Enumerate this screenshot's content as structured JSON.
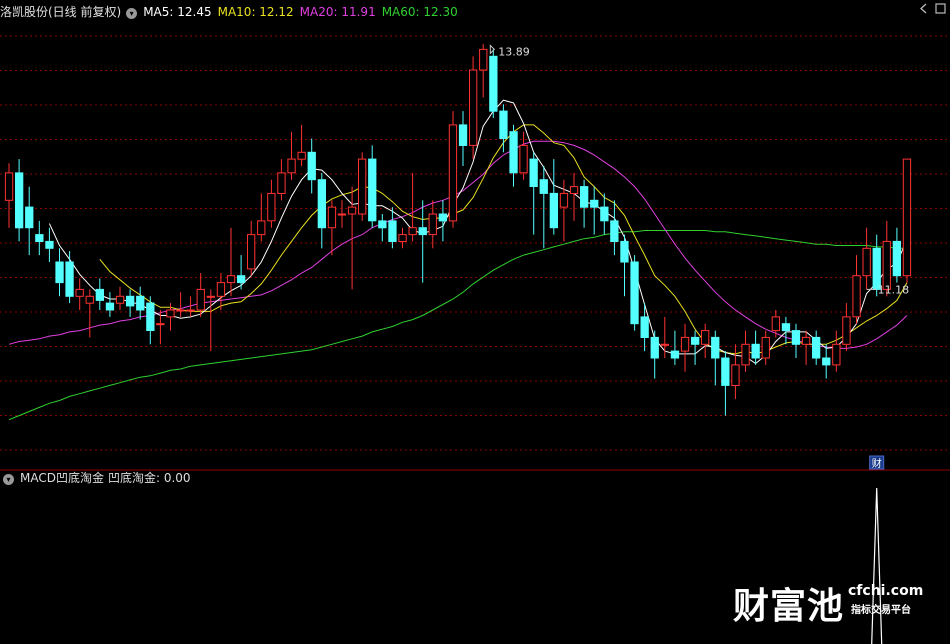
{
  "stock_title": "洛凯股份(日线 前复权)",
  "ma_legend": [
    {
      "label": "MA5: 12.45",
      "color": "#ffffff"
    },
    {
      "label": "MA10: 12.12",
      "color": "#e8e020"
    },
    {
      "label": "MA20: 11.91",
      "color": "#e040e0"
    },
    {
      "label": "MA60: 12.30",
      "color": "#30d030"
    }
  ],
  "indicator_title": "MACD凹底淘金",
  "indicator_value": "凹底淘金: 0.00",
  "watermark": {
    "brand": "财富池",
    "domain": "cfchi.com",
    "slogan": "指标交易平台"
  },
  "colors": {
    "up": "#ff3232",
    "down": "#54ffff",
    "grid": "#8b0000",
    "background": "#000000"
  },
  "chart_data": {
    "type": "candlestick",
    "price_range": [
      10.9,
      14.05
    ],
    "annotations": [
      {
        "text": "13.89",
        "candle_index": 48,
        "kind": "high"
      },
      {
        "text": "11.18",
        "candle_index": 85,
        "kind": "low"
      },
      {
        "text": "财",
        "candle_index": 86,
        "kind": "badge"
      }
    ],
    "candles": [
      [
        12.75,
        12.95,
        13.02,
        12.55
      ],
      [
        12.95,
        12.55,
        13.05,
        12.45
      ],
      [
        12.7,
        12.55,
        12.85,
        12.35
      ],
      [
        12.5,
        12.45,
        12.6,
        12.35
      ],
      [
        12.45,
        12.4,
        12.55,
        12.3
      ],
      [
        12.3,
        12.15,
        12.4,
        12.05
      ],
      [
        12.3,
        12.05,
        12.38,
        12.0
      ],
      [
        12.05,
        12.1,
        12.18,
        11.95
      ],
      [
        12.0,
        12.05,
        12.1,
        11.75
      ],
      [
        12.1,
        12.02,
        12.18,
        11.95
      ],
      [
        12.0,
        11.95,
        12.08,
        11.9
      ],
      [
        12.0,
        12.05,
        12.12,
        11.95
      ],
      [
        12.05,
        11.98,
        12.1,
        11.9
      ],
      [
        12.05,
        11.95,
        12.12,
        11.88
      ],
      [
        12.0,
        11.8,
        12.05,
        11.7
      ],
      [
        11.85,
        11.85,
        11.95,
        11.7
      ],
      [
        11.9,
        11.95,
        12.0,
        11.8
      ],
      [
        11.95,
        11.95,
        12.08,
        11.9
      ],
      [
        11.95,
        11.95,
        12.05,
        11.9
      ],
      [
        11.95,
        12.1,
        12.22,
        11.9
      ],
      [
        12.05,
        12.05,
        12.1,
        11.65
      ],
      [
        12.05,
        12.15,
        12.22,
        11.95
      ],
      [
        12.15,
        12.2,
        12.55,
        12.05
      ],
      [
        12.2,
        12.15,
        12.35,
        12.1
      ],
      [
        12.25,
        12.5,
        12.6,
        12.2
      ],
      [
        12.5,
        12.6,
        12.8,
        12.45
      ],
      [
        12.6,
        12.8,
        12.9,
        12.55
      ],
      [
        12.8,
        12.95,
        13.05,
        12.75
      ],
      [
        12.95,
        13.05,
        13.25,
        12.9
      ],
      [
        13.05,
        13.1,
        13.3,
        13.0
      ],
      [
        13.1,
        12.9,
        13.2,
        12.8
      ],
      [
        12.9,
        12.55,
        12.95,
        12.4
      ],
      [
        12.55,
        12.7,
        12.75,
        12.35
      ],
      [
        12.65,
        12.65,
        12.75,
        12.55
      ],
      [
        12.65,
        12.7,
        12.85,
        12.1
      ],
      [
        12.65,
        13.05,
        13.1,
        12.6
      ],
      [
        13.05,
        12.6,
        13.15,
        12.55
      ],
      [
        12.6,
        12.55,
        12.65,
        12.45
      ],
      [
        12.6,
        12.45,
        12.7,
        12.4
      ],
      [
        12.45,
        12.5,
        12.55,
        12.4
      ],
      [
        12.5,
        12.55,
        12.95,
        12.45
      ],
      [
        12.55,
        12.5,
        12.75,
        12.15
      ],
      [
        12.5,
        12.65,
        12.75,
        12.4
      ],
      [
        12.65,
        12.6,
        12.75,
        12.45
      ],
      [
        12.6,
        13.3,
        13.4,
        12.55
      ],
      [
        13.3,
        13.15,
        13.4,
        13.0
      ],
      [
        13.15,
        13.7,
        13.8,
        13.05
      ],
      [
        13.7,
        13.85,
        13.89,
        13.5
      ],
      [
        13.8,
        13.4,
        13.85,
        13.35
      ],
      [
        13.4,
        13.2,
        13.45,
        13.1
      ],
      [
        13.25,
        12.95,
        13.3,
        12.85
      ],
      [
        12.95,
        13.15,
        13.25,
        12.9
      ],
      [
        13.05,
        12.85,
        13.1,
        12.5
      ],
      [
        12.9,
        12.8,
        13.0,
        12.4
      ],
      [
        12.8,
        12.55,
        13.05,
        12.5
      ],
      [
        12.7,
        12.8,
        12.9,
        12.45
      ],
      [
        12.8,
        12.85,
        12.95,
        12.6
      ],
      [
        12.85,
        12.7,
        12.9,
        12.55
      ],
      [
        12.75,
        12.7,
        12.85,
        12.5
      ],
      [
        12.7,
        12.6,
        12.8,
        12.5
      ],
      [
        12.6,
        12.45,
        12.75,
        12.35
      ],
      [
        12.45,
        12.3,
        12.5,
        12.05
      ],
      [
        12.3,
        11.85,
        12.35,
        11.8
      ],
      [
        11.9,
        11.75,
        12.0,
        11.65
      ],
      [
        11.75,
        11.6,
        11.8,
        11.45
      ],
      [
        11.7,
        11.7,
        11.9,
        11.6
      ],
      [
        11.65,
        11.6,
        11.8,
        11.55
      ],
      [
        11.65,
        11.75,
        11.85,
        11.5
      ],
      [
        11.75,
        11.7,
        11.8,
        11.55
      ],
      [
        11.7,
        11.8,
        11.85,
        11.6
      ],
      [
        11.75,
        11.6,
        11.8,
        11.4
      ],
      [
        11.6,
        11.4,
        11.65,
        11.18
      ],
      [
        11.4,
        11.55,
        11.7,
        11.3
      ],
      [
        11.55,
        11.7,
        11.8,
        11.5
      ],
      [
        11.7,
        11.6,
        11.8,
        11.55
      ],
      [
        11.6,
        11.75,
        11.8,
        11.55
      ],
      [
        11.8,
        11.9,
        11.95,
        11.75
      ],
      [
        11.85,
        11.8,
        11.9,
        11.7
      ],
      [
        11.8,
        11.7,
        11.85,
        11.6
      ],
      [
        11.7,
        11.75,
        11.8,
        11.55
      ],
      [
        11.75,
        11.6,
        11.8,
        11.55
      ],
      [
        11.6,
        11.55,
        11.7,
        11.45
      ],
      [
        11.55,
        11.7,
        11.8,
        11.5
      ],
      [
        11.7,
        11.9,
        12.0,
        11.65
      ],
      [
        11.9,
        12.2,
        12.35,
        11.85
      ],
      [
        12.2,
        12.4,
        12.55,
        12.1
      ],
      [
        12.4,
        12.1,
        12.5,
        12.05
      ],
      [
        12.1,
        12.45,
        12.6,
        12.05
      ],
      [
        12.45,
        12.2,
        12.55,
        12.15
      ],
      [
        12.2,
        13.05,
        13.05,
        12.15
      ]
    ],
    "ma_series": [
      {
        "name": "MA5",
        "color": "#ffffff",
        "values": [
          null,
          null,
          null,
          null,
          12.58,
          12.42,
          12.32,
          12.21,
          12.13,
          12.06,
          12.03,
          12.03,
          12.01,
          11.99,
          11.95,
          11.91,
          11.91,
          11.89,
          11.9,
          11.92,
          11.98,
          12.04,
          12.09,
          12.13,
          12.2,
          12.3,
          12.45,
          12.62,
          12.78,
          12.9,
          12.98,
          12.97,
          12.9,
          12.8,
          12.72,
          12.73,
          12.71,
          12.71,
          12.67,
          12.62,
          12.53,
          12.51,
          12.53,
          12.56,
          12.72,
          12.84,
          13.03,
          13.29,
          13.4,
          13.48,
          13.46,
          13.31,
          13.1,
          12.99,
          12.86,
          12.83,
          12.8,
          12.74,
          12.72,
          12.67,
          12.62,
          12.48,
          12.24,
          11.99,
          11.74,
          11.65,
          11.63,
          11.63,
          11.63,
          11.69,
          11.68,
          11.64,
          11.62,
          11.61,
          11.56,
          11.62,
          11.72,
          11.79,
          11.79,
          11.79,
          11.73,
          11.67,
          11.68,
          11.75,
          11.85,
          12.07,
          12.15,
          12.25,
          12.29,
          12.47
        ]
      },
      {
        "name": "MA10",
        "color": "#e8e020",
        "values": [
          null,
          null,
          null,
          null,
          null,
          null,
          null,
          null,
          null,
          12.32,
          12.23,
          12.17,
          12.11,
          12.06,
          12.01,
          11.97,
          11.97,
          11.95,
          11.94,
          11.94,
          11.94,
          11.98,
          12.0,
          12.01,
          12.07,
          12.14,
          12.24,
          12.35,
          12.45,
          12.55,
          12.64,
          12.71,
          12.76,
          12.79,
          12.81,
          12.85,
          12.84,
          12.8,
          12.74,
          12.67,
          12.63,
          12.61,
          12.62,
          12.62,
          12.65,
          12.68,
          12.77,
          12.91,
          13.06,
          13.17,
          13.25,
          13.3,
          13.3,
          13.24,
          13.17,
          13.15,
          13.06,
          12.92,
          12.85,
          12.77,
          12.73,
          12.64,
          12.49,
          12.35,
          12.2,
          12.13,
          12.05,
          11.94,
          11.81,
          11.71,
          11.66,
          11.64,
          11.63,
          11.65,
          11.63,
          11.65,
          11.68,
          11.71,
          11.72,
          11.7,
          11.7,
          11.7,
          11.73,
          11.77,
          11.82,
          11.87,
          11.91,
          11.96,
          12.02,
          12.15
        ]
      },
      {
        "name": "MA20",
        "color": "#e040e0",
        "values": [
          11.7,
          11.72,
          11.73,
          11.74,
          11.76,
          11.77,
          11.79,
          11.8,
          11.82,
          11.84,
          11.85,
          11.87,
          11.88,
          11.9,
          11.91,
          11.93,
          11.95,
          11.96,
          11.98,
          12.0,
          12.01,
          12.02,
          12.03,
          12.04,
          12.05,
          12.06,
          12.09,
          12.13,
          12.17,
          12.22,
          12.26,
          12.32,
          12.38,
          12.43,
          12.47,
          12.5,
          12.55,
          12.58,
          12.61,
          12.63,
          12.66,
          12.7,
          12.73,
          12.75,
          12.78,
          12.82,
          12.88,
          12.94,
          13.02,
          13.08,
          13.12,
          13.16,
          13.18,
          13.18,
          13.18,
          13.17,
          13.15,
          13.12,
          13.08,
          13.03,
          12.98,
          12.92,
          12.85,
          12.76,
          12.65,
          12.54,
          12.43,
          12.33,
          12.24,
          12.16,
          12.08,
          12.01,
          11.95,
          11.9,
          11.85,
          11.81,
          11.78,
          11.75,
          11.73,
          11.71,
          11.69,
          11.68,
          11.67,
          11.67,
          11.68,
          11.7,
          11.74,
          11.79,
          11.84,
          11.91
        ]
      },
      {
        "name": "MA60",
        "color": "#30d030",
        "values": [
          11.15,
          11.18,
          11.21,
          11.24,
          11.27,
          11.29,
          11.32,
          11.34,
          11.36,
          11.38,
          11.4,
          11.42,
          11.44,
          11.46,
          11.47,
          11.49,
          11.51,
          11.52,
          11.54,
          11.55,
          11.56,
          11.57,
          11.58,
          11.59,
          11.6,
          11.61,
          11.62,
          11.63,
          11.64,
          11.65,
          11.66,
          11.68,
          11.7,
          11.72,
          11.74,
          11.76,
          11.79,
          11.81,
          11.83,
          11.86,
          11.88,
          11.91,
          11.95,
          11.99,
          12.03,
          12.08,
          12.14,
          12.19,
          12.24,
          12.28,
          12.32,
          12.35,
          12.37,
          12.39,
          12.41,
          12.43,
          12.45,
          12.47,
          12.48,
          12.5,
          12.51,
          12.52,
          12.52,
          12.53,
          12.53,
          12.53,
          12.53,
          12.53,
          12.53,
          12.53,
          12.52,
          12.52,
          12.51,
          12.5,
          12.49,
          12.48,
          12.47,
          12.46,
          12.45,
          12.44,
          12.43,
          12.43,
          12.42,
          12.42,
          12.42,
          12.42,
          12.41,
          12.41,
          12.4,
          12.4
        ]
      }
    ],
    "indicator": {
      "name": "凹底淘金",
      "range": [
        0,
        1
      ],
      "values": [
        0,
        0,
        0,
        0,
        0,
        0,
        0,
        0,
        0,
        0,
        0,
        0,
        0,
        0,
        0,
        0,
        0,
        0,
        0,
        0,
        0,
        0,
        0,
        0,
        0,
        0,
        0,
        0,
        0,
        0,
        0,
        0,
        0,
        0,
        0,
        0,
        0,
        0,
        0,
        0,
        0,
        0,
        0,
        0,
        0,
        0,
        0,
        0,
        0,
        0,
        0,
        0,
        0,
        0,
        0,
        0,
        0,
        0,
        0,
        0,
        0,
        0,
        0,
        0,
        0,
        0,
        0,
        0,
        0,
        0,
        0,
        0,
        0,
        0,
        0,
        0,
        0,
        0,
        0,
        0,
        0,
        0,
        0,
        0,
        0,
        0,
        1,
        0,
        0,
        0
      ]
    }
  }
}
